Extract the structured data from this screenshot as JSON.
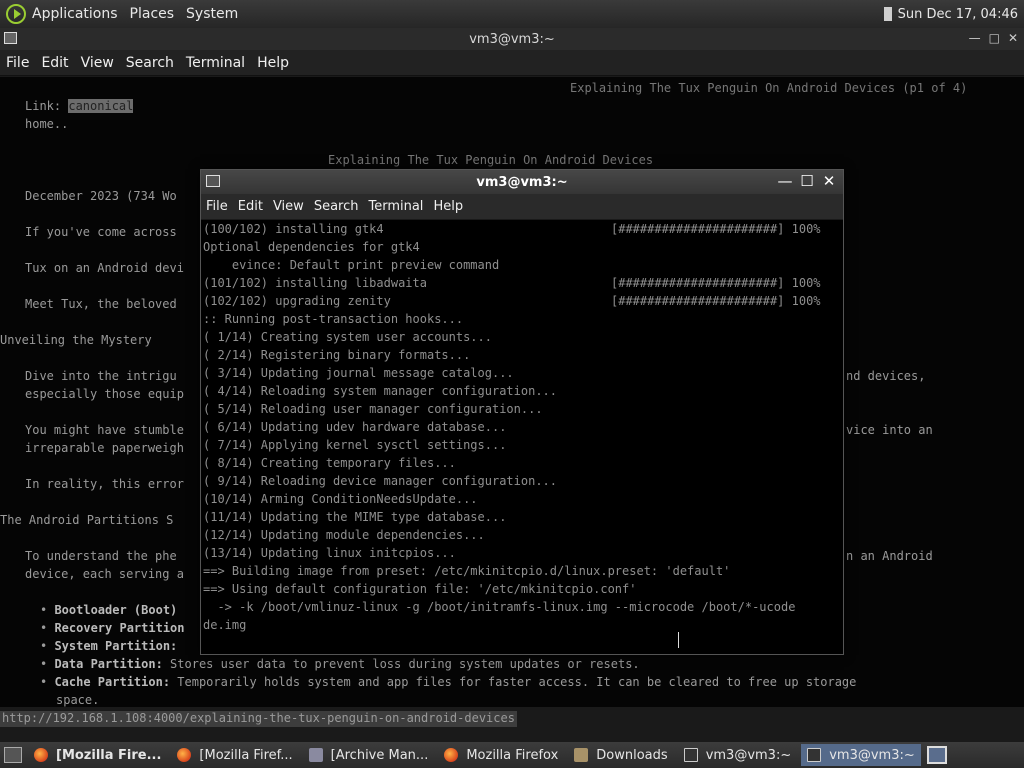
{
  "top_panel": {
    "menus": [
      "Applications",
      "Places",
      "System"
    ],
    "clock": "Sun Dec 17, 04:46"
  },
  "bg_window": {
    "title": "vm3@vm3:~",
    "menu": [
      "File",
      "Edit",
      "View",
      "Search",
      "Terminal",
      "Help"
    ],
    "lines": [
      "Explaining The Tux Penguin On Android Devices (p1 of 4)",
      "Link: ",
      "canonical",
      "home..",
      "Explaining The Tux Penguin On Android Devices",
      "December 2023 (734 Wo",
      "If you've come across",
      "Tux on an Android devi",
      "Meet Tux, the beloved",
      "Unveiling the Mystery",
      "Dive into the intrigu",
      "nd devices,",
      "especially those equip",
      "You might have stumble",
      "vice into an",
      "irreparable paperweigh",
      "In reality, this error",
      "The Android Partitions S",
      "To understand the phe",
      "n an Android",
      "device, each serving a",
      "Bootloader (Boot)",
      "Recovery Partition",
      "System Partition:",
      "Data Partition:",
      " Stores user data to prevent loss during system updates or resets.",
      "Cache Partition:",
      " Temporarily holds system and app files for faster access. It can be cleared to free up storage",
      "space."
    ],
    "status_url": "http://192.168.1.108:4000/explaining-the-tux-penguin-on-android-devices"
  },
  "fg_window": {
    "title": "vm3@vm3:~",
    "menu": [
      "File",
      "Edit",
      "View",
      "Search",
      "Terminal",
      "Help"
    ],
    "lines": [
      "(100/102) installing gtk4",
      "Optional dependencies for gtk4",
      "    evince: Default print preview command",
      "(101/102) installing libadwaita",
      "(102/102) upgrading zenity",
      ":: Running post-transaction hooks...",
      "( 1/14) Creating system user accounts...",
      "( 2/14) Registering binary formats...",
      "( 3/14) Updating journal message catalog...",
      "( 4/14) Reloading system manager configuration...",
      "( 5/14) Reloading user manager configuration...",
      "( 6/14) Updating udev hardware database...",
      "( 7/14) Applying kernel sysctl settings...",
      "( 8/14) Creating temporary files...",
      "( 9/14) Reloading device manager configuration...",
      "(10/14) Arming ConditionNeedsUpdate...",
      "(11/14) Updating the MIME type database...",
      "(12/14) Updating module dependencies...",
      "(13/14) Updating linux initcpios...",
      "==> Building image from preset: /etc/mkinitcpio.d/linux.preset: 'default'",
      "==> Using default configuration file: '/etc/mkinitcpio.conf'",
      "  -> -k /boot/vmlinuz-linux -g /boot/initramfs-linux.img --microcode /boot/*-ucode",
      "de.img"
    ],
    "progress_bars": [
      "[######################] 100%",
      "[######################] 100%",
      "[######################] 100%"
    ]
  },
  "taskbar": {
    "tasks": [
      {
        "label": "[Mozilla Fire...",
        "icon": "firefox-icon",
        "bold": true,
        "active": false
      },
      {
        "label": "[Mozilla Firef...",
        "icon": "firefox-icon",
        "bold": false,
        "active": false
      },
      {
        "label": "[Archive Man...",
        "icon": "archive-manager-icon",
        "bold": false,
        "active": false
      },
      {
        "label": "Mozilla Firefox",
        "icon": "firefox-icon",
        "bold": false,
        "active": false
      },
      {
        "label": "Downloads",
        "icon": "folder-icon",
        "bold": false,
        "active": false
      },
      {
        "label": "vm3@vm3:~",
        "icon": "terminal-icon",
        "bold": false,
        "active": false
      },
      {
        "label": "vm3@vm3:~",
        "icon": "terminal-icon",
        "bold": false,
        "active": true
      }
    ]
  }
}
